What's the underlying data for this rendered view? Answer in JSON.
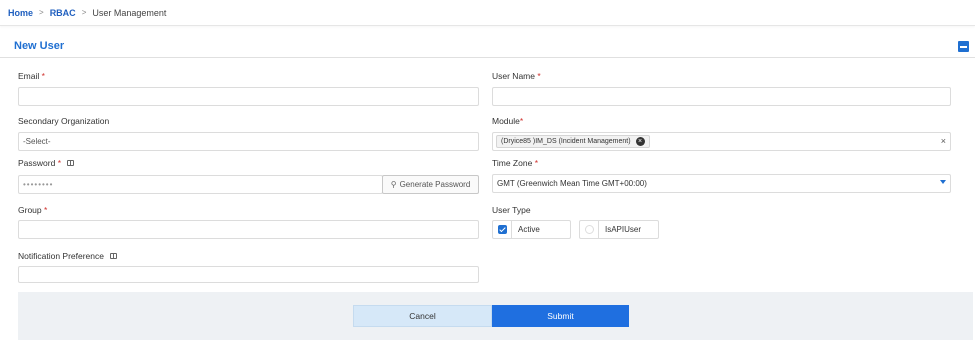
{
  "breadcrumb": {
    "home": "Home",
    "rbac": "RBAC",
    "current": "User Management",
    "separator": ">"
  },
  "section": {
    "title": "New User"
  },
  "form": {
    "email": {
      "label": "Email",
      "required": "*",
      "value": ""
    },
    "username": {
      "label": "User Name",
      "required": "*",
      "value": ""
    },
    "secondary_org": {
      "label": "Secondary Organization",
      "value": "-Select-"
    },
    "module": {
      "label": "Module",
      "required": "*",
      "chip": "(Dryice85 )IM_DS (Incident Management)",
      "chip_remove": "×",
      "clear": "×"
    },
    "password": {
      "label": "Password",
      "required": "*",
      "value": "••••••••",
      "generate_label": "Generate Password"
    },
    "timezone": {
      "label": "Time Zone",
      "required": "*",
      "value": "GMT (Greenwich Mean Time GMT+00:00)"
    },
    "group": {
      "label": "Group",
      "required": "*",
      "value": ""
    },
    "user_type": {
      "label": "User Type",
      "options": [
        {
          "label": "Active",
          "checked": true
        },
        {
          "label": "IsAPIUser",
          "checked": false
        }
      ]
    },
    "notification": {
      "label": "Notification Preference",
      "value": ""
    }
  },
  "actions": {
    "cancel": "Cancel",
    "submit": "Submit"
  },
  "colors": {
    "accent": "#1f6fd1",
    "required": "#d0312d",
    "submit": "#1f6fe0",
    "cancel": "#d6e8f8"
  }
}
